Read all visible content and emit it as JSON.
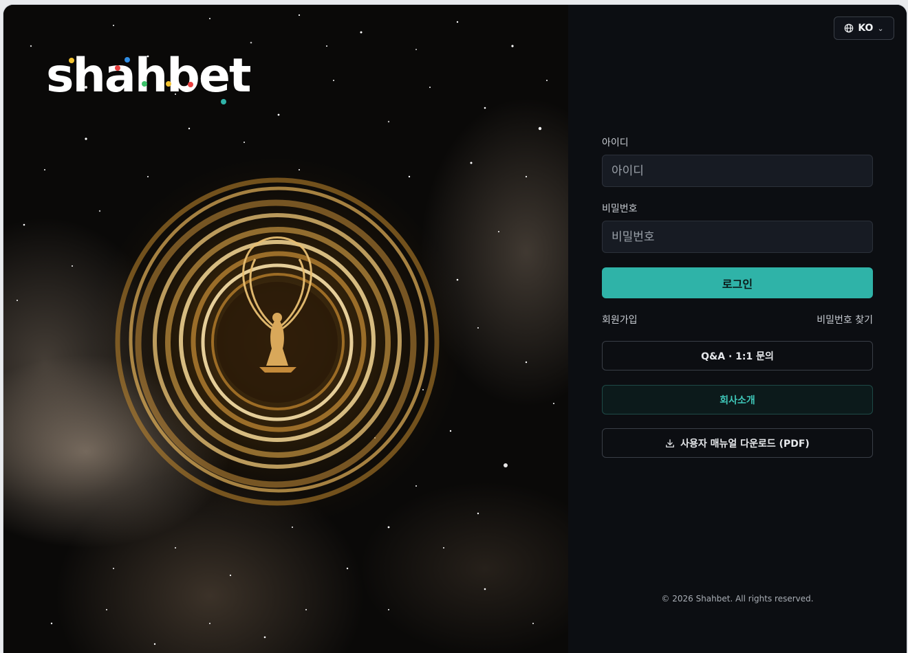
{
  "brand": {
    "logo_text": "shahbet",
    "logo_dot_colors": [
      "#f2c230",
      "#e83f3f",
      "#2f8de4",
      "#3cc26a",
      "#f2c230",
      "#e83f3f",
      "#2fb3a8"
    ]
  },
  "language": {
    "selected": "KO",
    "icon": "globe-icon"
  },
  "form": {
    "username": {
      "label": "아이디",
      "placeholder": "아이디",
      "value": ""
    },
    "password": {
      "label": "비밀번호",
      "placeholder": "비밀번호",
      "value": ""
    },
    "login_label": "로그인"
  },
  "links": {
    "signup": "회원가입",
    "find_password": "비밀번호 찾기"
  },
  "buttons": {
    "qa": "Q&A · 1:1 문의",
    "company": "회사소개",
    "manual": "사용자 매뉴얼 다운로드 (PDF)",
    "manual_icon": "download-icon"
  },
  "footer": {
    "copyright": "© 2026 Shahbet. All rights reserved."
  },
  "colors": {
    "accent": "#2fb3a8",
    "panel_bg": "#0c0e12",
    "input_bg": "#171b23"
  }
}
